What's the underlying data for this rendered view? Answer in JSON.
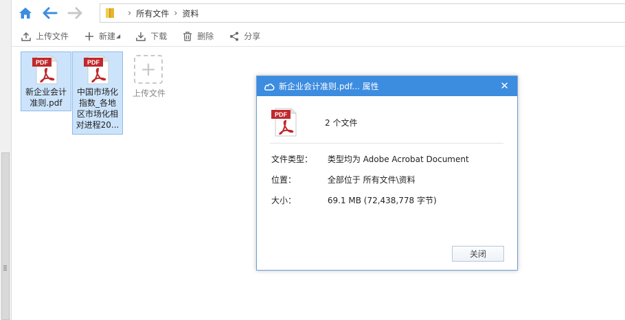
{
  "nav": {
    "path": [
      "所有文件",
      "资料"
    ]
  },
  "toolbar": {
    "upload": "上传文件",
    "new": "新建",
    "download": "下载",
    "delete": "删除",
    "share": "分享"
  },
  "files": [
    {
      "badge": "PDF",
      "name_line1": "新企业会计",
      "name_line2": "准则.pdf"
    },
    {
      "badge": "PDF",
      "name_line1": "中国市场化",
      "name_line2": "指数_各地",
      "name_line3": "区市场化相",
      "name_line4": "对进程20..."
    }
  ],
  "upload_tile": {
    "label": "上传文件"
  },
  "dialog": {
    "title": "新企业会计准则.pdf... 属性",
    "badge": "PDF",
    "count": "2 个文件",
    "rows": [
      {
        "key": "文件类型：",
        "value": "类型均为  Adobe Acrobat Document"
      },
      {
        "key": "位置：",
        "value": "全部位于  所有文件\\资料"
      },
      {
        "key": "大小：",
        "value": "69.1 MB (72,438,778 字节)"
      }
    ],
    "close_button": "关闭"
  },
  "colors": {
    "accent": "#3c8ce0",
    "selection": "#cce4fb",
    "pdf_red": "#c0282d"
  }
}
